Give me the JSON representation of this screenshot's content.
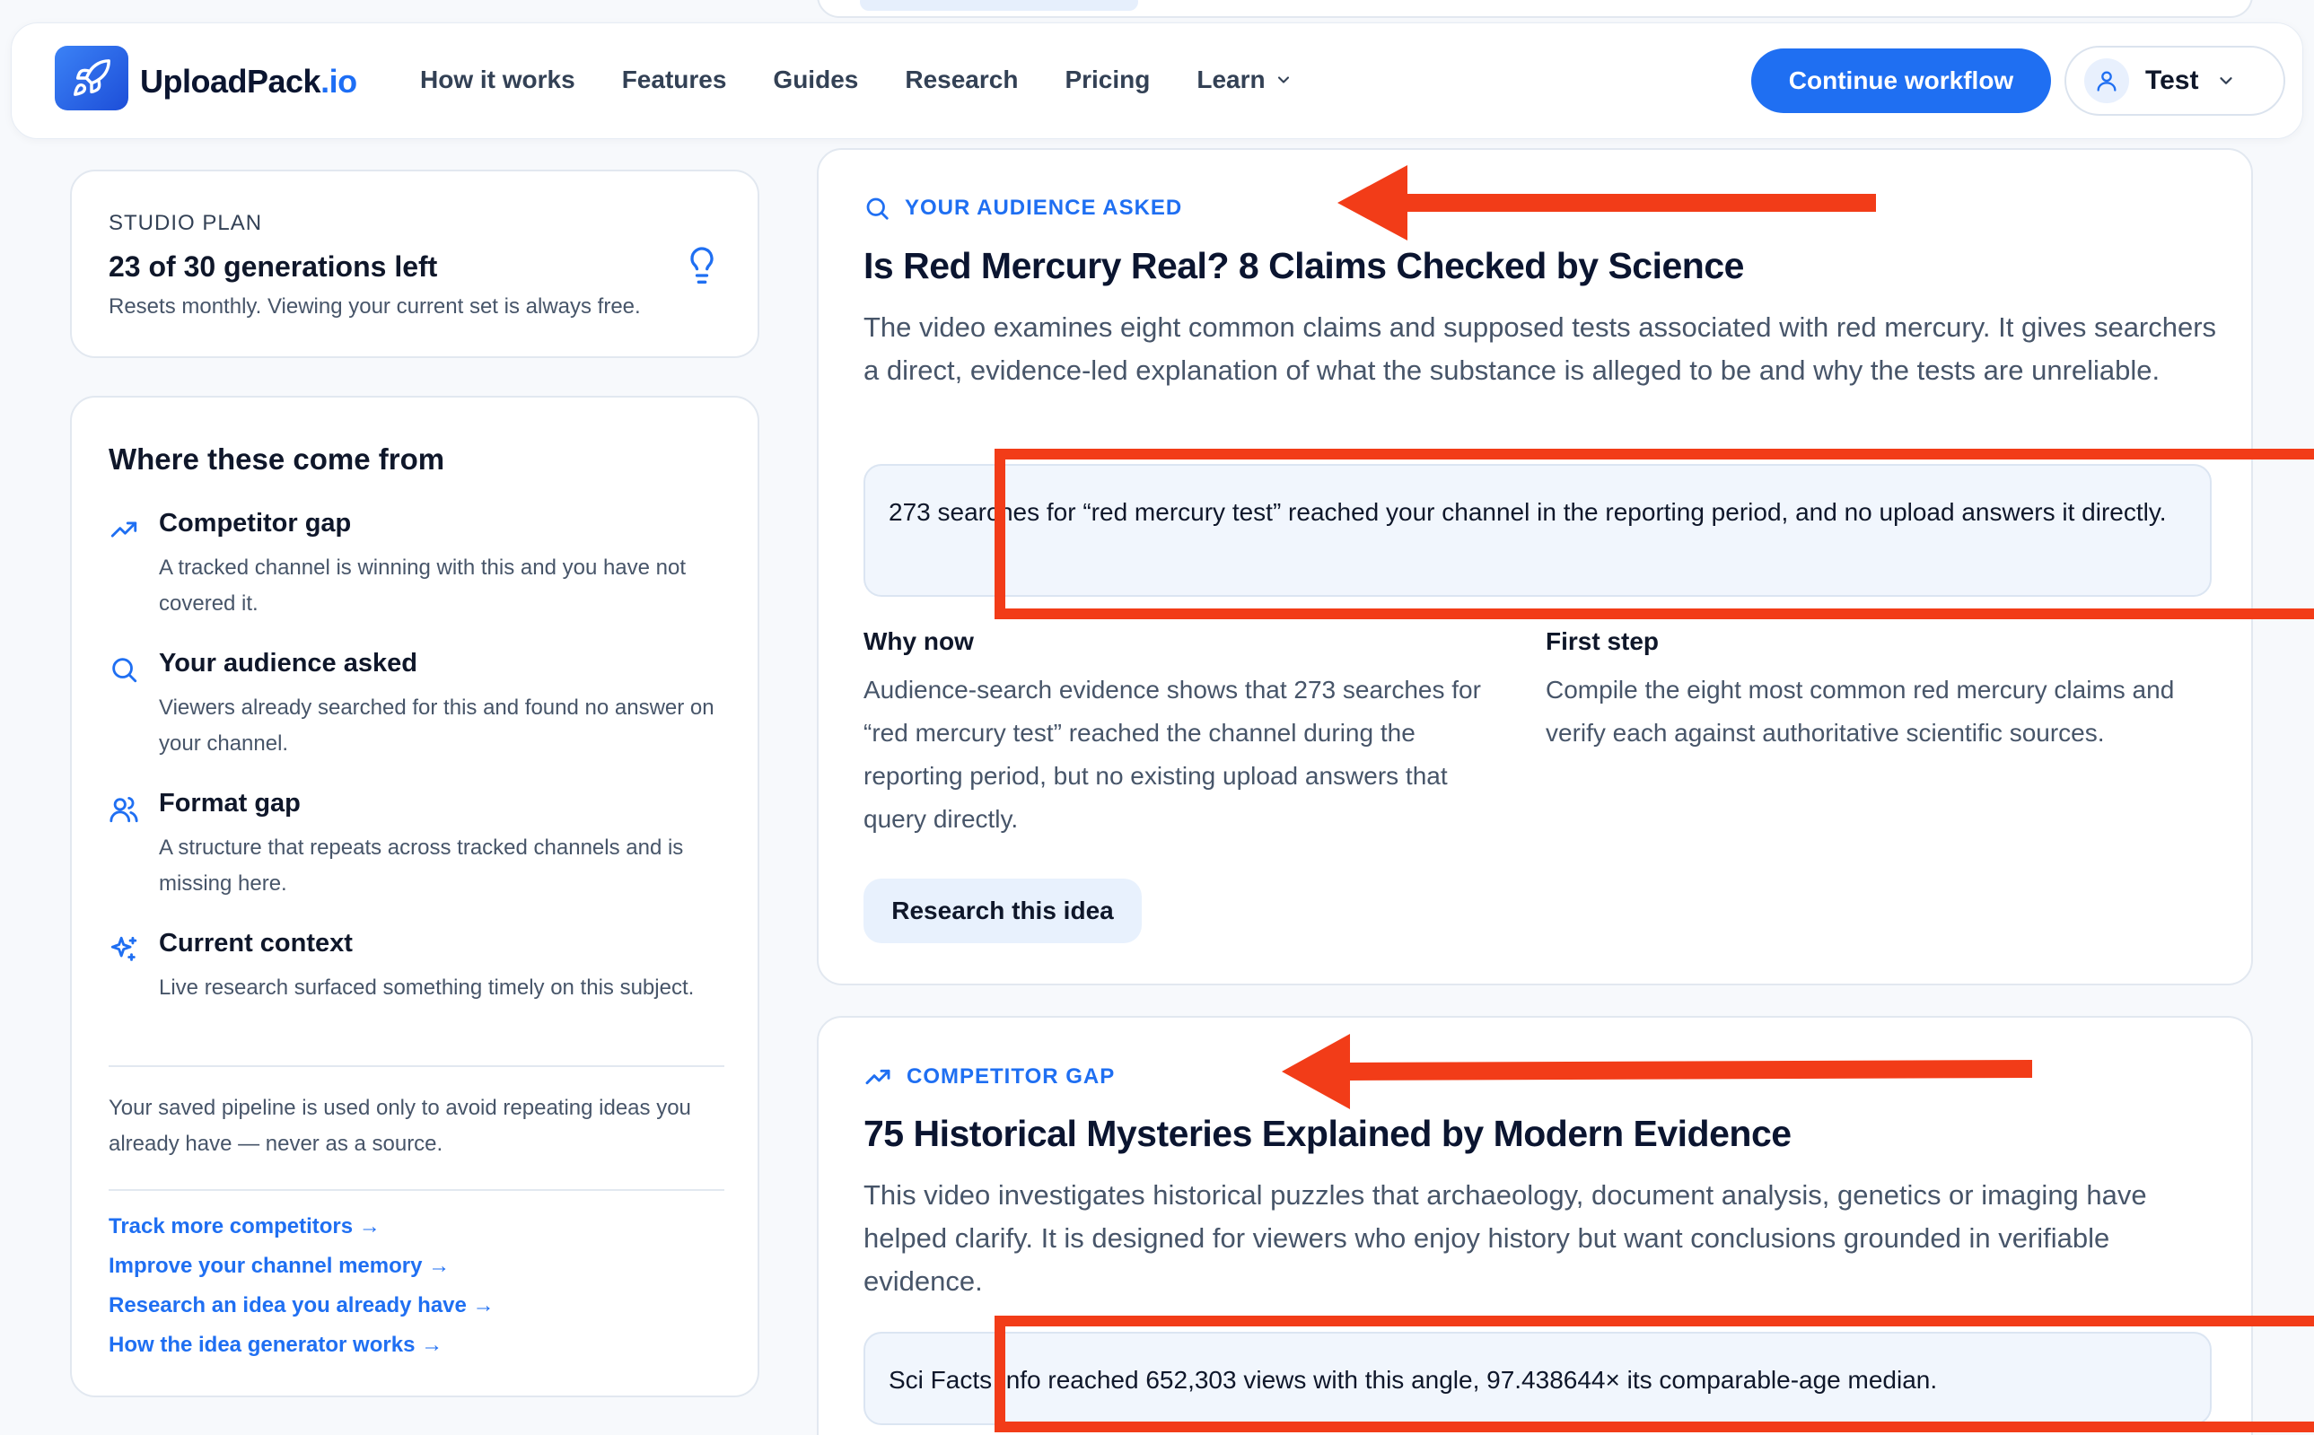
{
  "header": {
    "brand_main": "UploadPack",
    "brand_tld": ".io",
    "nav": [
      {
        "label": "How it works"
      },
      {
        "label": "Features"
      },
      {
        "label": "Guides"
      },
      {
        "label": "Research"
      },
      {
        "label": "Pricing"
      },
      {
        "label": "Learn"
      }
    ],
    "cta_label": "Continue workflow",
    "user_name": "Test"
  },
  "plan": {
    "label": "STUDIO PLAN",
    "count": "23 of 30 generations left",
    "note": "Resets monthly. Viewing your current set is always free."
  },
  "sources": {
    "title": "Where these come from",
    "items": [
      {
        "name": "Competitor gap",
        "desc": "A tracked channel is winning with this and you have not covered it.",
        "icon": "trending-up-icon"
      },
      {
        "name": "Your audience asked",
        "desc": "Viewers already searched for this and found no answer on your channel.",
        "icon": "search-icon"
      },
      {
        "name": "Format gap",
        "desc": "A structure that repeats across tracked channels and is missing here.",
        "icon": "users-icon"
      },
      {
        "name": "Current context",
        "desc": "Live research surfaced something timely on this subject.",
        "icon": "sparkles-icon"
      }
    ],
    "saved_note": "Your saved pipeline is used only to avoid repeating ideas you already have — never as a source.",
    "links": [
      "Track more competitors →",
      "Improve your channel memory →",
      "Research an idea you already have →",
      "How the idea generator works →"
    ]
  },
  "ideas": [
    {
      "tag": "YOUR AUDIENCE ASKED",
      "title": "Is Red Mercury Real? 8 Claims Checked by Science",
      "desc": "The video examines eight common claims and supposed tests associated with red mercury. It gives searchers a direct, evidence-led explanation of what the substance is alleged to be and why the tests are unreliable.",
      "evidence": "273 searches for “red mercury test” reached your channel in the reporting period, and no upload answers it directly.",
      "why_now_title": "Why now",
      "why_now": "Audience-search evidence shows that 273 searches for “red mercury test” reached the channel during the reporting period, but no existing upload answers that query directly.",
      "first_step_title": "First step",
      "first_step": "Compile the eight most common red mercury claims and verify each against authoritative scientific sources.",
      "button": "Research this idea"
    },
    {
      "tag": "COMPETITOR GAP",
      "title": "75 Historical Mysteries Explained by Modern Evidence",
      "desc": "This video investigates historical puzzles that archaeology, document analysis, genetics or imaging have helped clarify. It is designed for viewers who enjoy history but want conclusions grounded in verifiable evidence.",
      "evidence": "Sci Facts Info reached 652,303 views with this angle, 97.438644× its comparable-age median."
    }
  ],
  "colors": {
    "accent": "#1f6ff2",
    "annotation": "#f23c18"
  }
}
